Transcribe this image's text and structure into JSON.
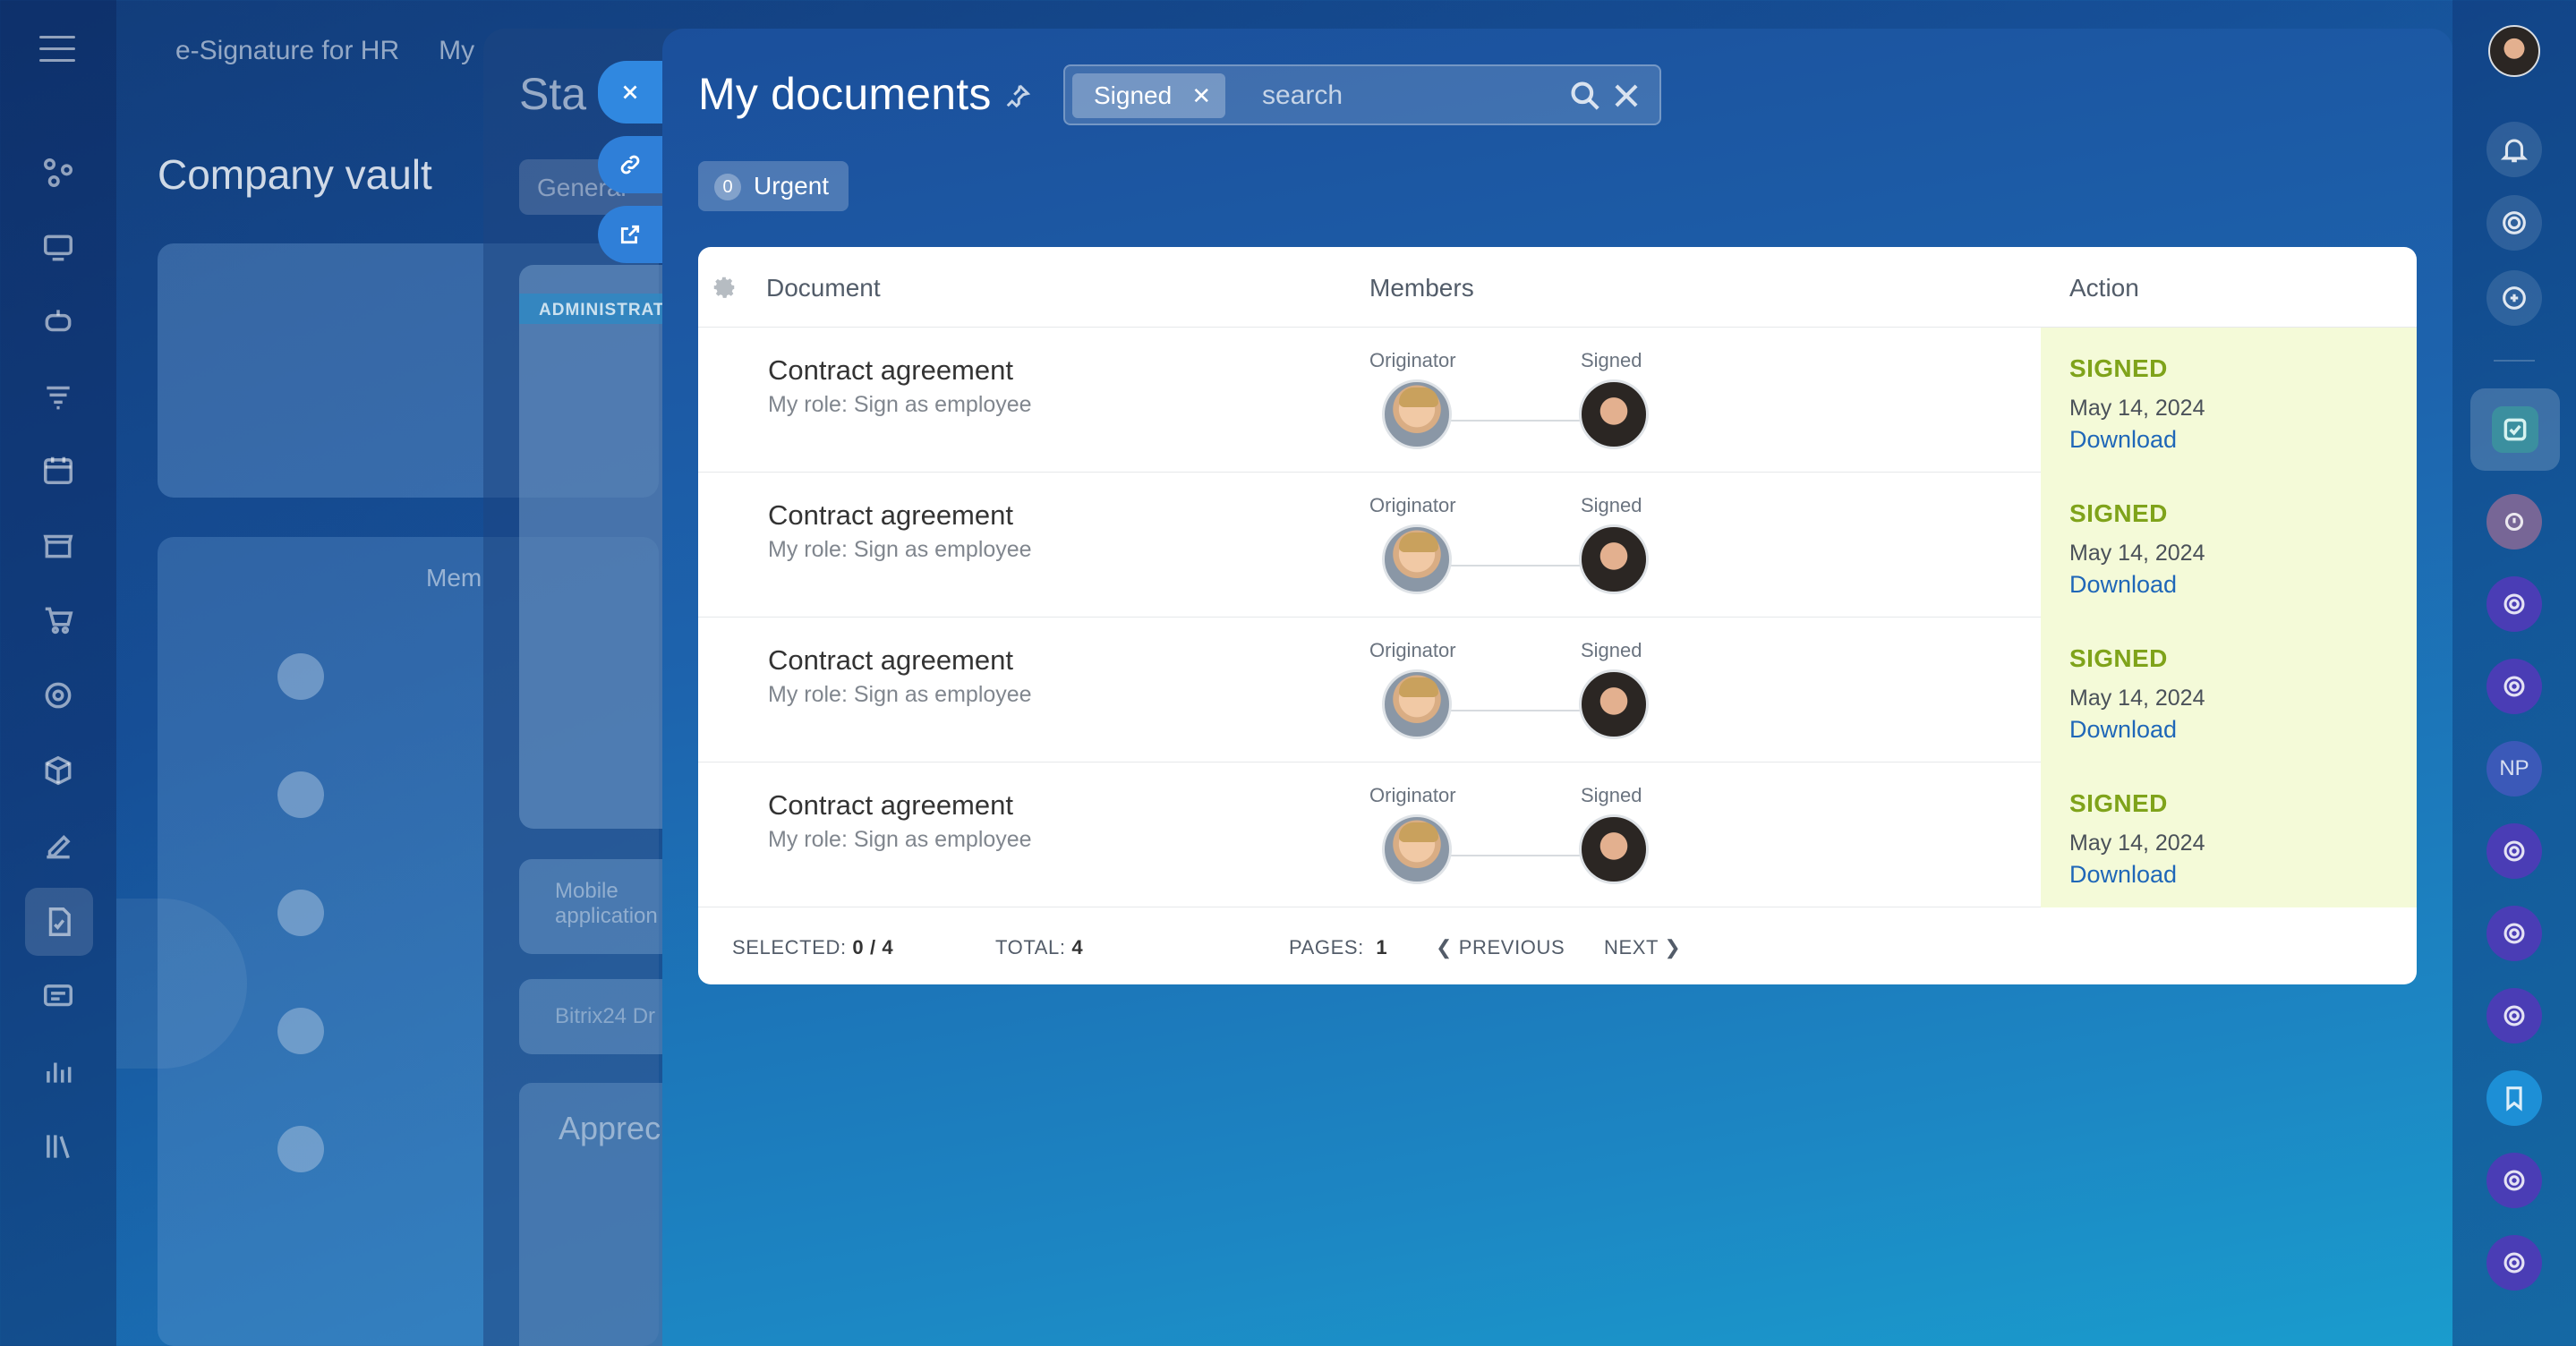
{
  "background": {
    "top_nav": [
      "e-Signature for HR",
      "My"
    ],
    "vault_title": "Company vault",
    "members_label": "Mem"
  },
  "stacked_panel": {
    "title": "Sta",
    "tab": "General",
    "admin_label": "ADMINISTRAT",
    "mobile_label": "Mobile application",
    "bitrix_label": "Bitrix24 Dr",
    "appreciation_label": "Apprec"
  },
  "slider": {
    "title": "My documents",
    "filter_chip": "Signed",
    "search_placeholder": "search",
    "urgent": {
      "count": "0",
      "label": "Urgent"
    }
  },
  "table": {
    "columns": {
      "document": "Document",
      "members": "Members",
      "action": "Action"
    },
    "rows": [
      {
        "document": "Contract agreement",
        "role": "My role: Sign as employee",
        "originator_label": "Originator",
        "signer_label": "Signed",
        "status": "SIGNED",
        "date": "May 14, 2024",
        "download": "Download"
      },
      {
        "document": "Contract agreement",
        "role": "My role: Sign as employee",
        "originator_label": "Originator",
        "signer_label": "Signed",
        "status": "SIGNED",
        "date": "May 14, 2024",
        "download": "Download"
      },
      {
        "document": "Contract agreement",
        "role": "My role: Sign as employee",
        "originator_label": "Originator",
        "signer_label": "Signed",
        "status": "SIGNED",
        "date": "May 14, 2024",
        "download": "Download"
      },
      {
        "document": "Contract agreement",
        "role": "My role: Sign as employee",
        "originator_label": "Originator",
        "signer_label": "Signed",
        "status": "SIGNED",
        "date": "May 14, 2024",
        "download": "Download"
      }
    ],
    "footer": {
      "selected_label": "SELECTED:",
      "selected_value": "0 / 4",
      "total_label": "TOTAL:",
      "total_value": "4",
      "pages_label": "PAGES:",
      "pages_value": "1",
      "previous": "PREVIOUS",
      "next": "NEXT"
    }
  },
  "right_rail": {
    "np_badge": "NP"
  },
  "colors": {
    "signed_status": "#7fa31a",
    "action_bg": "#f4fad8",
    "link": "#1f67b8"
  },
  "icons": [
    "menu-icon",
    "settings-gear-icon",
    "pin-icon",
    "search-icon",
    "close-icon",
    "link-icon",
    "external-link-icon",
    "bell-icon",
    "chevron-left-icon",
    "chevron-right-icon",
    "checklist-icon",
    "bookmark-icon"
  ]
}
